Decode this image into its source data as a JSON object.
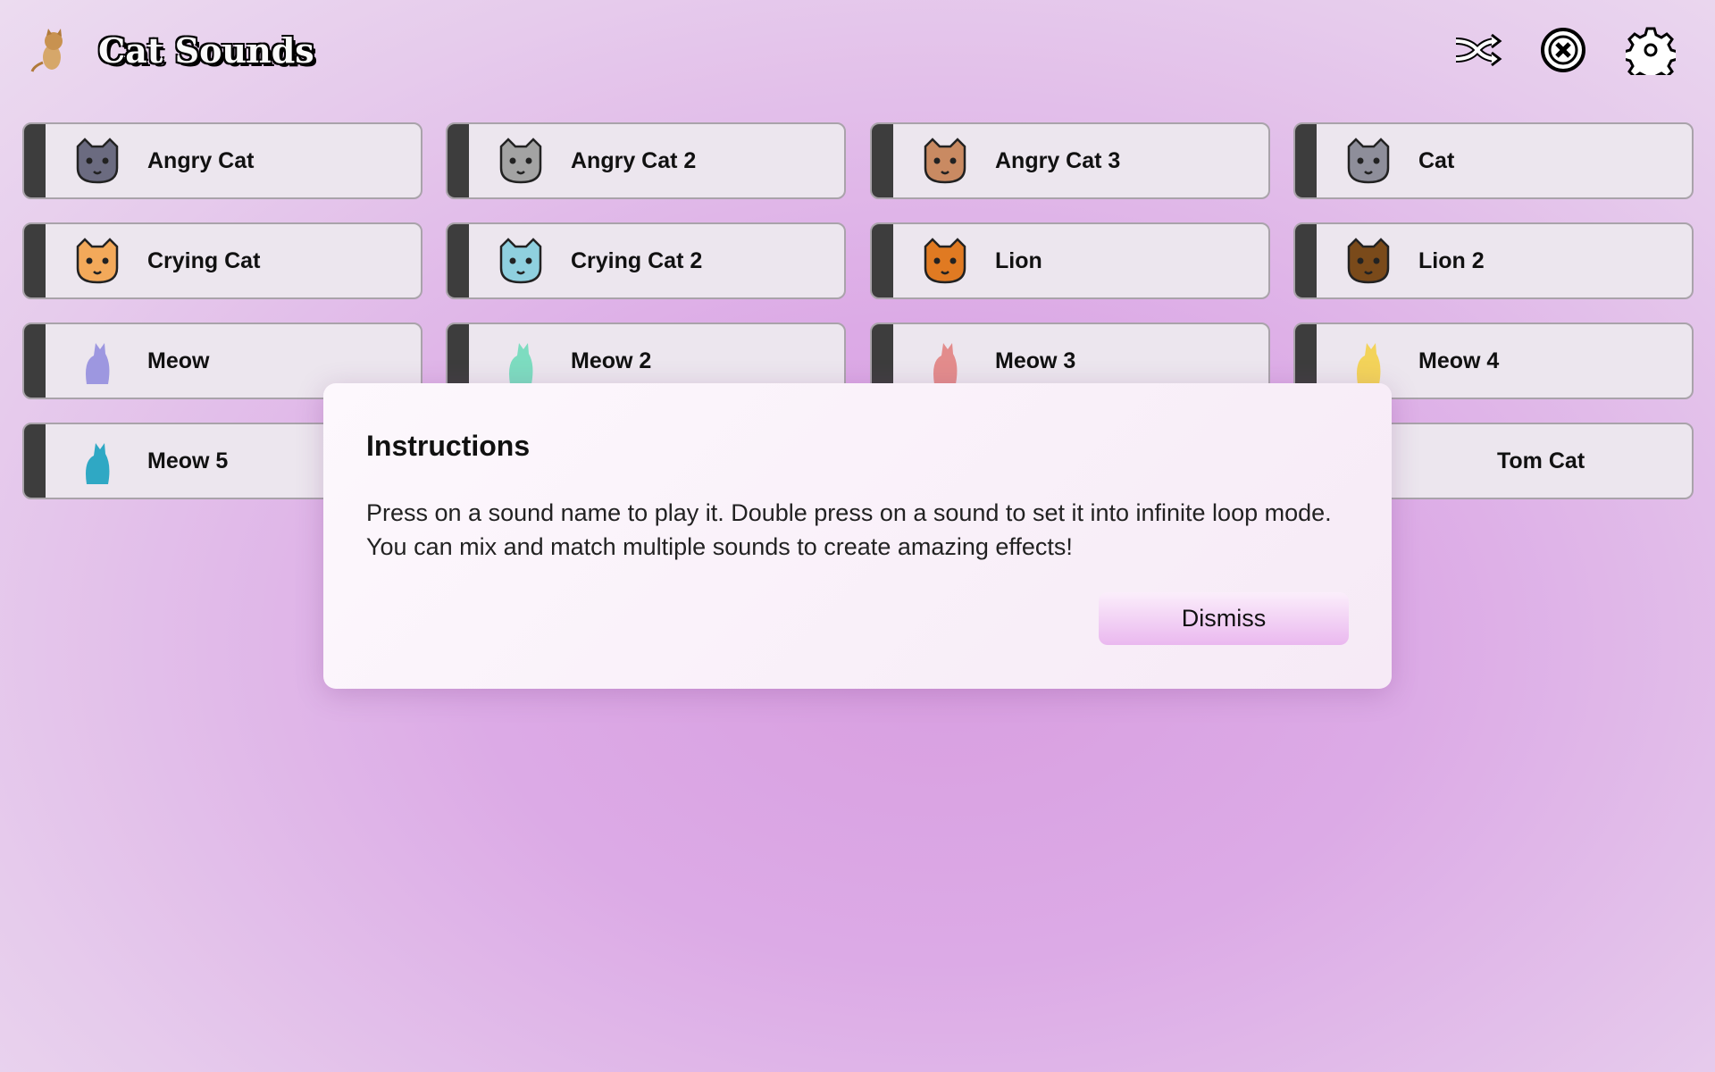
{
  "app": {
    "title": "Cat Sounds",
    "logo": "kitten-image"
  },
  "header_icons": [
    "shuffle-icon",
    "stop-all-icon",
    "settings-icon"
  ],
  "sounds": [
    {
      "label": "Angry Cat",
      "icon": "angry-cat-face-icon",
      "color": "#6b6b80"
    },
    {
      "label": "Angry Cat 2",
      "icon": "angry-cat-face-2-icon",
      "color": "#a3a3a3"
    },
    {
      "label": "Angry Cat 3",
      "icon": "angry-tabby-face-icon",
      "color": "#c98a62"
    },
    {
      "label": "Cat",
      "icon": "cat-face-icon",
      "color": "#8e8e9a"
    },
    {
      "label": "Crying Cat",
      "icon": "crying-cat-face-icon",
      "color": "#f3a95a"
    },
    {
      "label": "Crying Cat 2",
      "icon": "crying-cat-face-2-icon",
      "color": "#8fd0df"
    },
    {
      "label": "Lion",
      "icon": "lion-face-icon",
      "color": "#e07a22"
    },
    {
      "label": "Lion 2",
      "icon": "lion-face-2-icon",
      "color": "#7a4a1a"
    },
    {
      "label": "Meow",
      "icon": "cat-silhouette-icon",
      "color": "#9d97e0"
    },
    {
      "label": "Meow 2",
      "icon": "cat-silhouette-2-icon",
      "color": "#7ddcc0"
    },
    {
      "label": "Meow 3",
      "icon": "cat-silhouette-3-icon",
      "color": "#e38c8c"
    },
    {
      "label": "Meow 4",
      "icon": "cat-moon-icon",
      "color": "#f3d35a"
    },
    {
      "label": "Meow 5",
      "icon": "cat-silhouette-5-icon",
      "color": "#2fa8c4"
    },
    {
      "label": "Tom Cat",
      "icon": "",
      "color": ""
    }
  ],
  "dialog": {
    "title": "Instructions",
    "body": "Press on a sound name to play it. Double press on a sound to set it into infinite loop mode. You can mix and match multiple sounds to create amazing effects!",
    "dismiss_label": "Dismiss"
  }
}
